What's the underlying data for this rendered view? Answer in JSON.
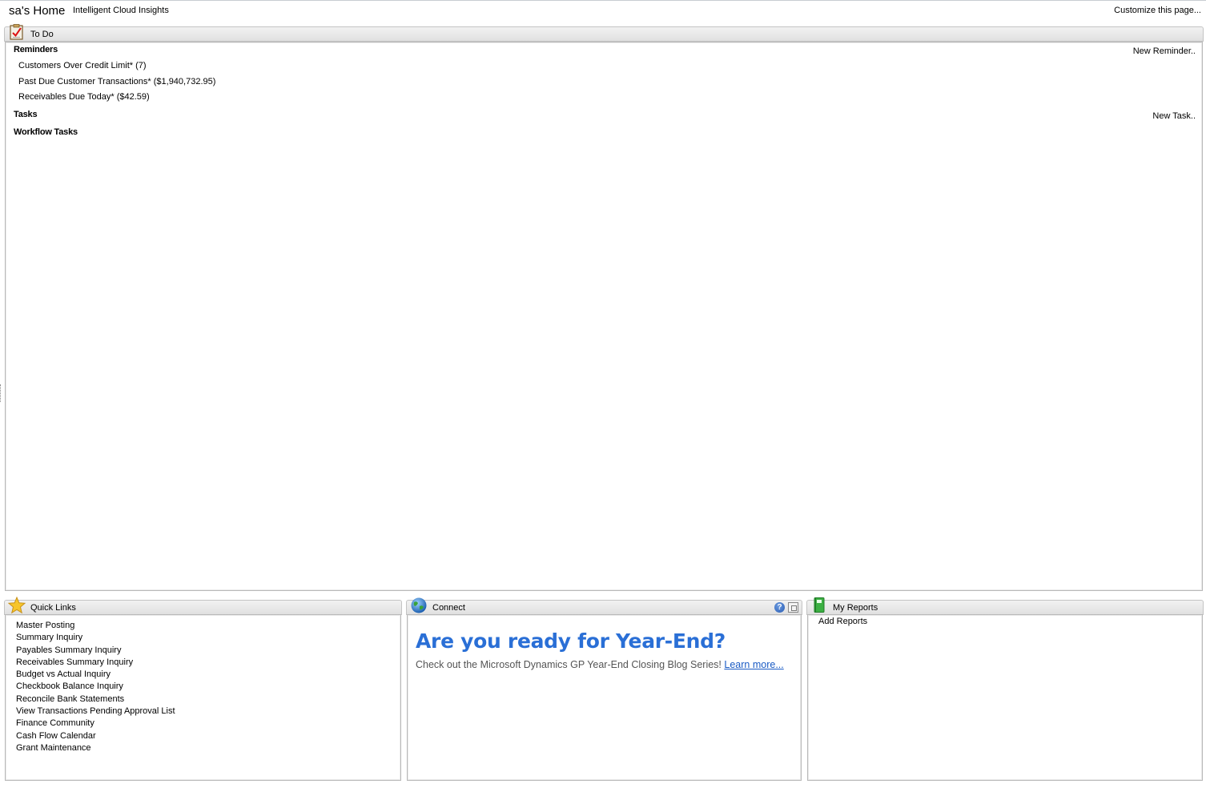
{
  "header": {
    "title": "sa's Home",
    "ici_link": "Intelligent Cloud Insights",
    "customize_link": "Customize this page..."
  },
  "todo": {
    "title": "To Do",
    "icon": "clipboard-check-icon",
    "reminders": {
      "label": "Reminders",
      "new_label": "New Reminder..",
      "items": [
        "Customers Over Credit Limit* (7)",
        "Past Due Customer Transactions* ($1,940,732.95)",
        "Receivables Due Today* ($42.59)"
      ]
    },
    "tasks": {
      "label": "Tasks",
      "new_label": "New Task.."
    },
    "workflow": {
      "label": "Workflow Tasks"
    }
  },
  "quick_links": {
    "title": "Quick Links",
    "icon": "star-icon",
    "items": [
      "Master Posting",
      "Summary Inquiry",
      "Payables Summary Inquiry",
      "Receivables Summary Inquiry",
      "Budget vs Actual Inquiry",
      "Checkbook Balance Inquiry",
      "Reconcile Bank Statements",
      "View Transactions Pending Approval List",
      "Finance Community",
      "Cash Flow Calendar",
      "Grant Maintenance"
    ]
  },
  "connect": {
    "title": "Connect",
    "icon": "globe-icon",
    "headline": "Are you ready for Year-End?",
    "description": "Check out the Microsoft Dynamics GP Year-End Closing Blog Series!",
    "link": "Learn more...",
    "help_glyph": "?"
  },
  "my_reports": {
    "title": "My Reports",
    "icon": "green-book-icon",
    "add_label": "Add Reports"
  },
  "colors": {
    "headline": "#2a6fd6",
    "link": "#1a5bc4",
    "header_gradient_top": "#f2f2f2",
    "header_gradient_bottom": "#e0e0e0"
  }
}
